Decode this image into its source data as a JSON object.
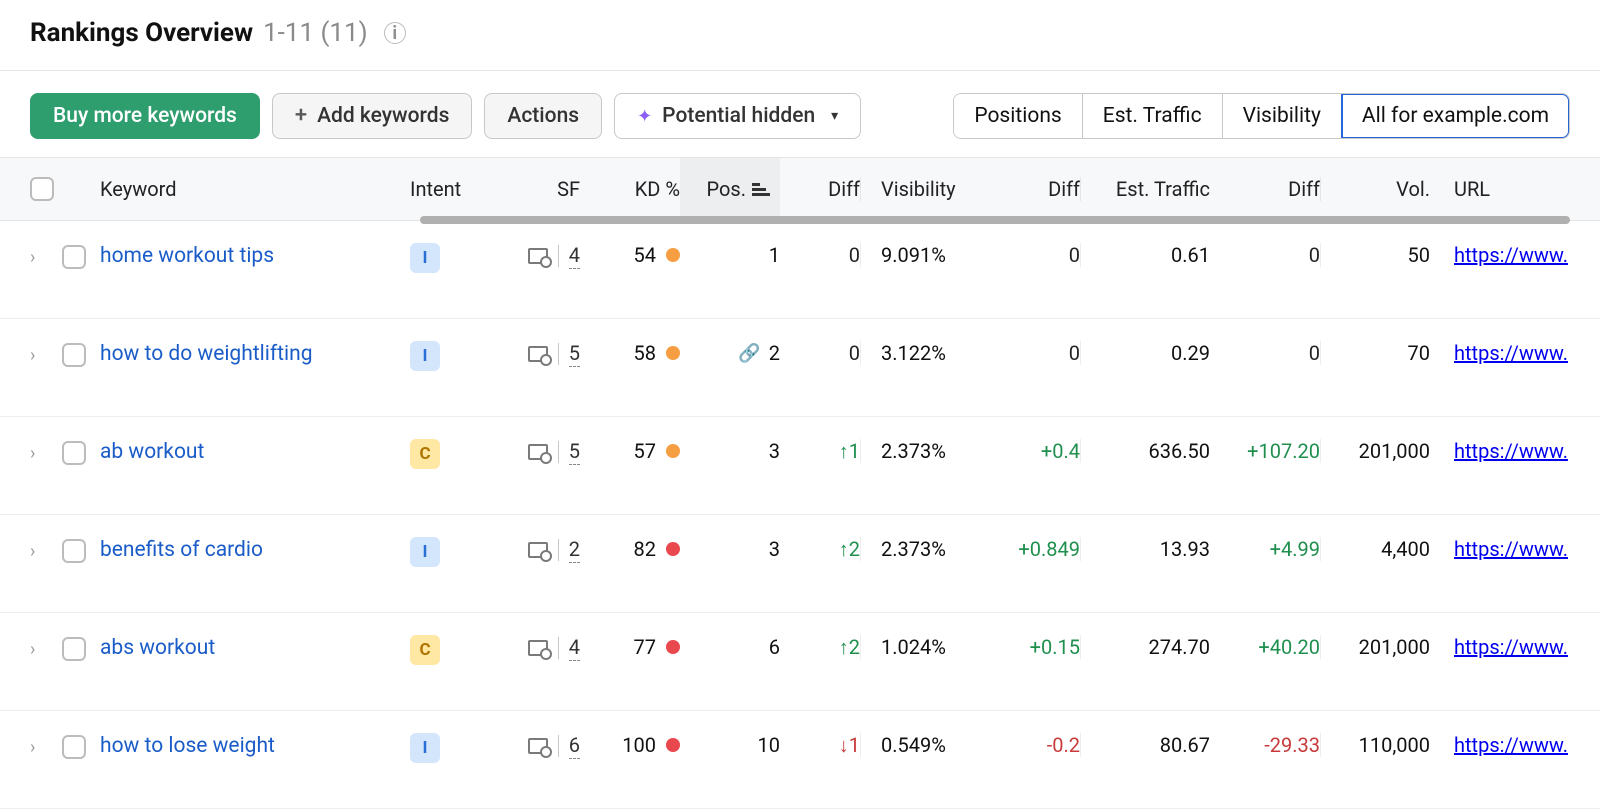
{
  "header": {
    "title": "Rankings Overview",
    "range": "1-11 (11)"
  },
  "toolbar": {
    "buy": "Buy more keywords",
    "add": "Add keywords",
    "actions": "Actions",
    "potential": "Potential hidden",
    "segments": {
      "positions": "Positions",
      "traffic": "Est. Traffic",
      "visibility": "Visibility",
      "allfor": "All for example.com"
    }
  },
  "columns": {
    "keyword": "Keyword",
    "intent": "Intent",
    "sf": "SF",
    "kd": "KD %",
    "pos": "Pos.",
    "diff": "Diff",
    "visibility": "Visibility",
    "diff2": "Diff",
    "traffic": "Est. Traffic",
    "diff3": "Diff",
    "vol": "Vol.",
    "url": "URL"
  },
  "rows": [
    {
      "keyword": "home workout tips",
      "intent": "I",
      "sf": "4",
      "kd": "54",
      "kd_color": "orange",
      "pos_prefix": "",
      "pos": "1",
      "d1": "0",
      "d1_dir": "neutral",
      "vis": "9.091%",
      "d2": "0",
      "d2_dir": "neutral",
      "traf": "0.61",
      "d3": "0",
      "d3_dir": "neutral",
      "vol": "50",
      "url": "https://www."
    },
    {
      "keyword": "how to do weightlifting",
      "intent": "I",
      "sf": "5",
      "kd": "58",
      "kd_color": "orange",
      "pos_prefix": "link",
      "pos": "2",
      "d1": "0",
      "d1_dir": "neutral",
      "vis": "3.122%",
      "d2": "0",
      "d2_dir": "neutral",
      "traf": "0.29",
      "d3": "0",
      "d3_dir": "neutral",
      "vol": "70",
      "url": "https://www."
    },
    {
      "keyword": "ab workout",
      "intent": "C",
      "sf": "5",
      "kd": "57",
      "kd_color": "orange",
      "pos_prefix": "",
      "pos": "3",
      "d1": "↑1",
      "d1_dir": "up",
      "vis": "2.373%",
      "d2": "+0.4",
      "d2_dir": "up",
      "traf": "636.50",
      "d3": "+107.20",
      "d3_dir": "up",
      "vol": "201,000",
      "url": "https://www."
    },
    {
      "keyword": "benefits of cardio",
      "intent": "I",
      "sf": "2",
      "kd": "82",
      "kd_color": "red",
      "pos_prefix": "",
      "pos": "3",
      "d1": "↑2",
      "d1_dir": "up",
      "vis": "2.373%",
      "d2": "+0.849",
      "d2_dir": "up",
      "traf": "13.93",
      "d3": "+4.99",
      "d3_dir": "up",
      "vol": "4,400",
      "url": "https://www."
    },
    {
      "keyword": "abs workout",
      "intent": "C",
      "sf": "4",
      "kd": "77",
      "kd_color": "red",
      "pos_prefix": "",
      "pos": "6",
      "d1": "↑2",
      "d1_dir": "up",
      "vis": "1.024%",
      "d2": "+0.15",
      "d2_dir": "up",
      "traf": "274.70",
      "d3": "+40.20",
      "d3_dir": "up",
      "vol": "201,000",
      "url": "https://www."
    },
    {
      "keyword": "how to lose weight",
      "intent": "I",
      "sf": "6",
      "kd": "100",
      "kd_color": "red",
      "pos_prefix": "",
      "pos": "10",
      "d1": "↓1",
      "d1_dir": "down",
      "vis": "0.549%",
      "d2": "-0.2",
      "d2_dir": "down",
      "traf": "80.67",
      "d3": "-29.33",
      "d3_dir": "down",
      "vol": "110,000",
      "url": "https://www."
    }
  ]
}
